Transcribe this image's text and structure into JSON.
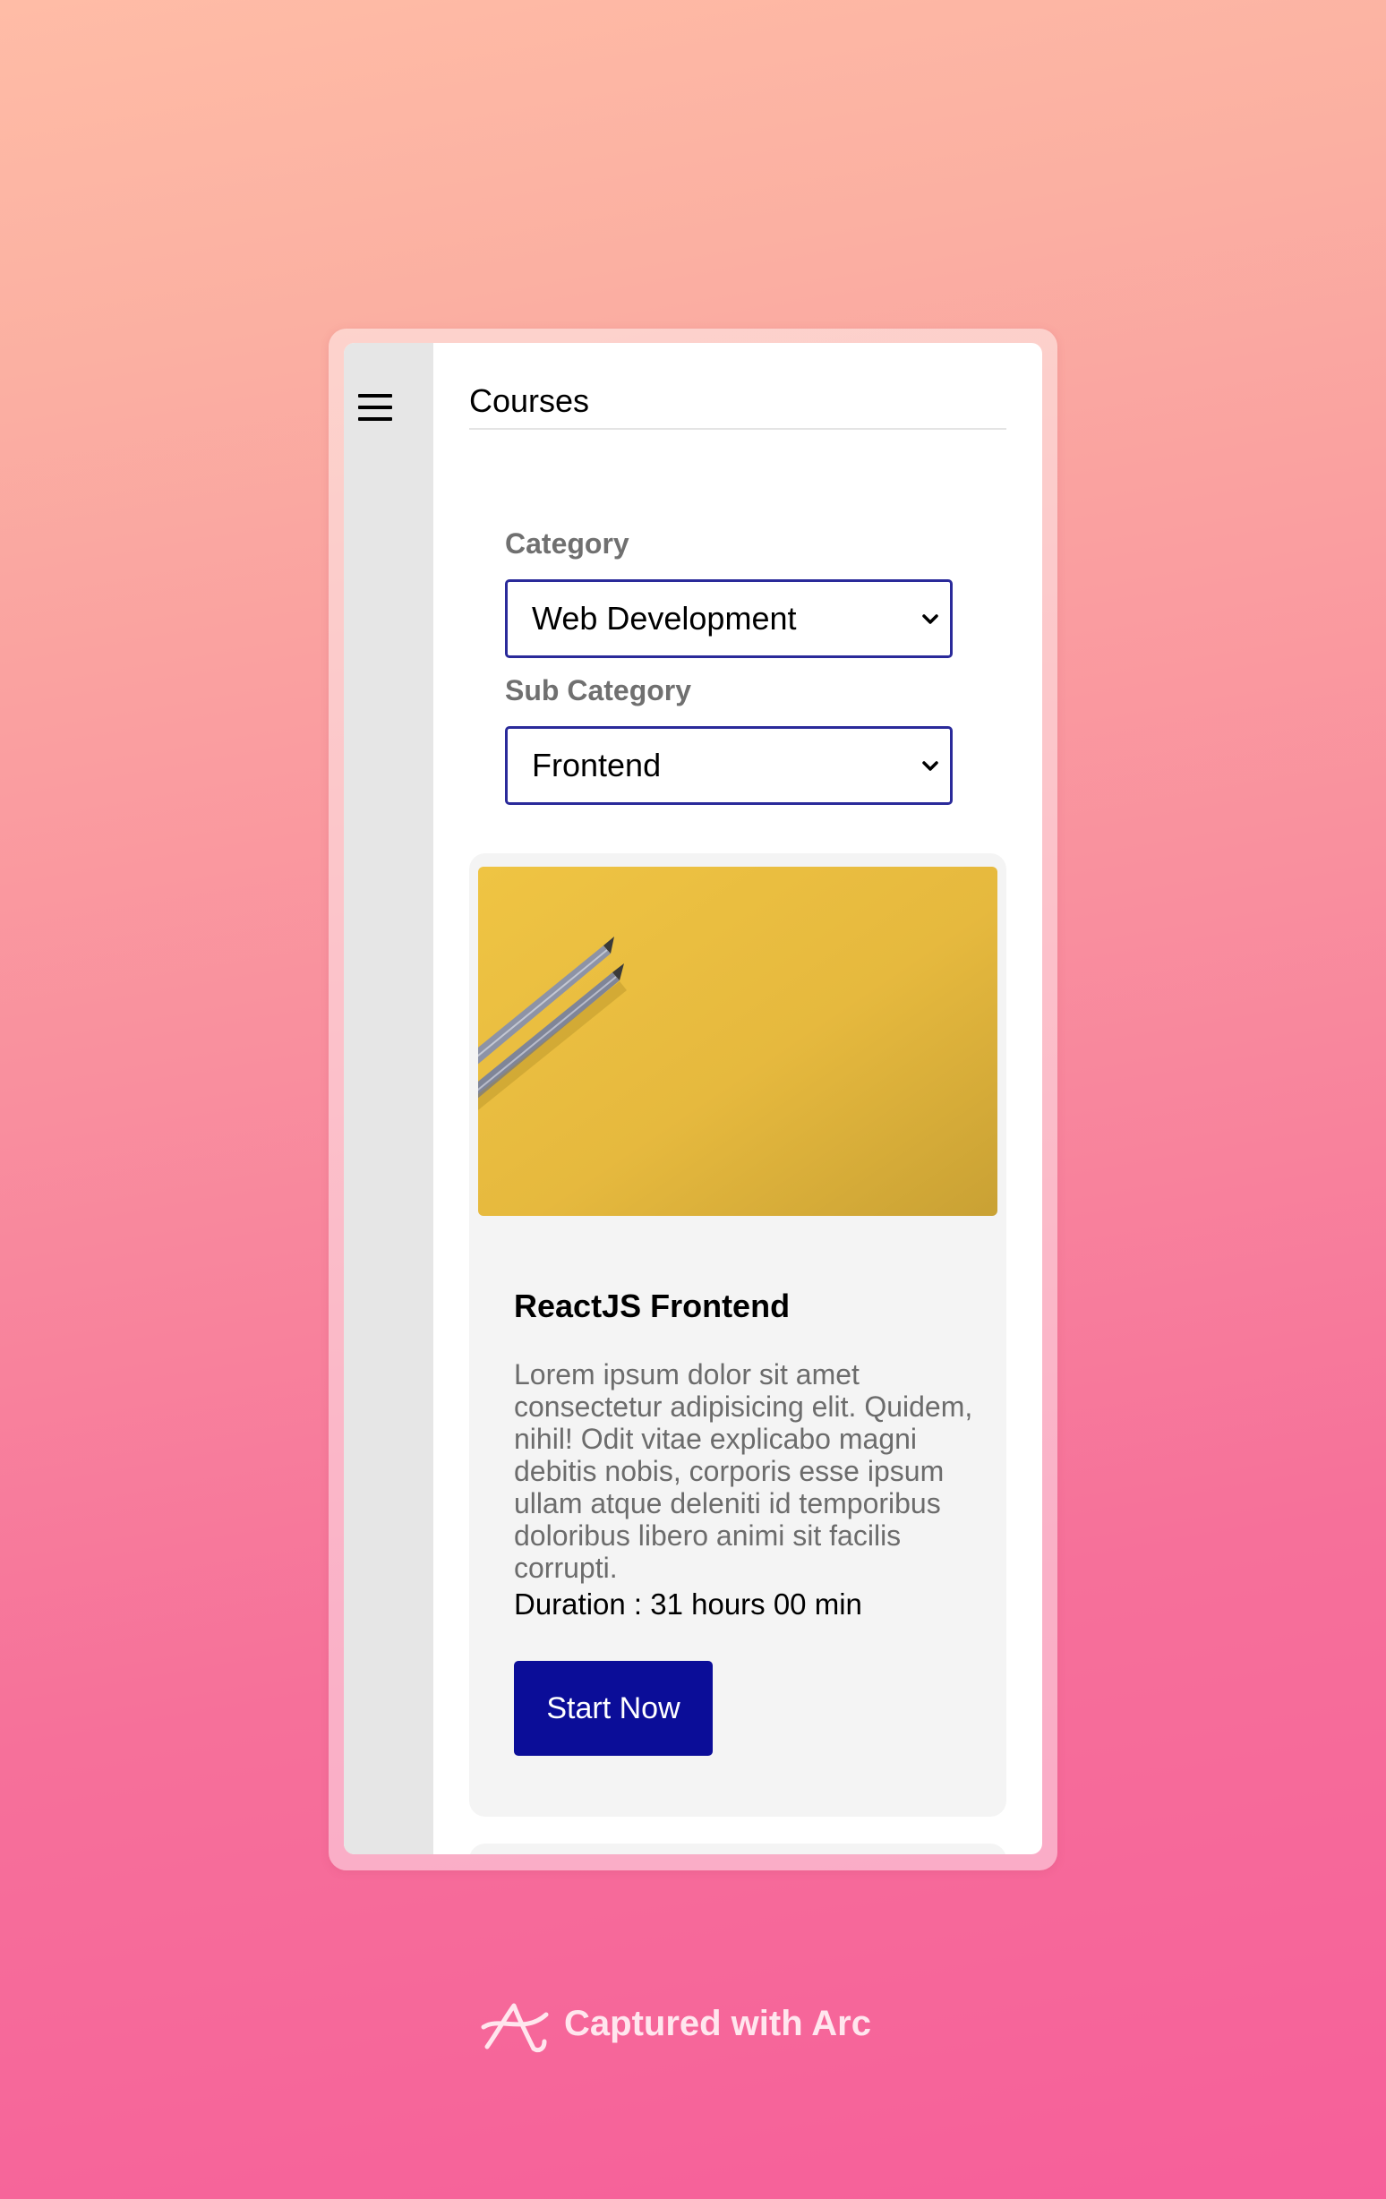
{
  "header": {
    "title": "Courses"
  },
  "sidebar": {
    "menu_icon": "hamburger-menu-icon"
  },
  "filters": {
    "category_label": "Category",
    "category_value": "Web Development",
    "subcategory_label": "Sub Category",
    "subcategory_value": "Frontend"
  },
  "course": {
    "image_alt": "pencils-on-yellow-background",
    "title": "ReactJS Frontend",
    "description": "Lorem ipsum dolor sit amet consectetur adipisicing elit. Quidem, nihil! Odit vitae explicabo magni debitis nobis, corporis esse ipsum ullam atque deleniti id temporibus doloribus libero animi sit facilis corrupti.",
    "duration": "Duration : 31 hours 00 min",
    "button_label": "Start Now"
  },
  "footer": {
    "capture_text": "Captured with Arc",
    "logo_icon": "arc-logo-icon"
  },
  "colors": {
    "button": "#0b0d98",
    "select_border": "#2a2a9a",
    "sidebar": "#e6e6e6",
    "card": "#f4f4f4"
  }
}
